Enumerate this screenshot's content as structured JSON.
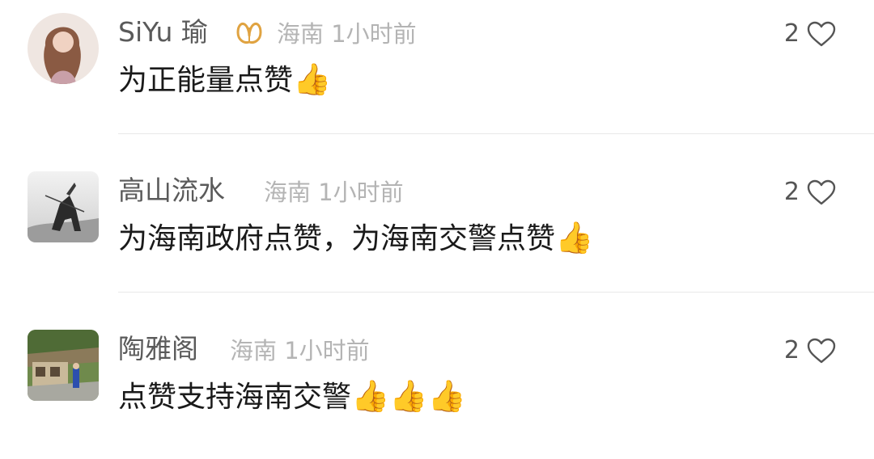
{
  "colors": {
    "username": "#5a5a5a",
    "meta": "#b4b4b4",
    "text": "#1a1a1a",
    "badge": "#e0a341",
    "divider": "#e8e8e8"
  },
  "comments": [
    {
      "username": "SiYu 瑜",
      "badge_icon": "butterfly-badge-icon",
      "location": "海南",
      "time": "1小时前",
      "text": "为正能量点赞",
      "emoji": "👍",
      "likes": "2",
      "like_icon": "heart-outline-icon"
    },
    {
      "username": "高山流水",
      "location": "海南",
      "time": "1小时前",
      "text": "为海南政府点赞，为海南交警点赞",
      "emoji": "👍",
      "likes": "2",
      "like_icon": "heart-outline-icon"
    },
    {
      "username": "陶雅阁",
      "location": "海南",
      "time": "1小时前",
      "text": "点赞支持海南交警",
      "emoji": "👍👍👍",
      "likes": "2",
      "like_icon": "heart-outline-icon"
    }
  ]
}
